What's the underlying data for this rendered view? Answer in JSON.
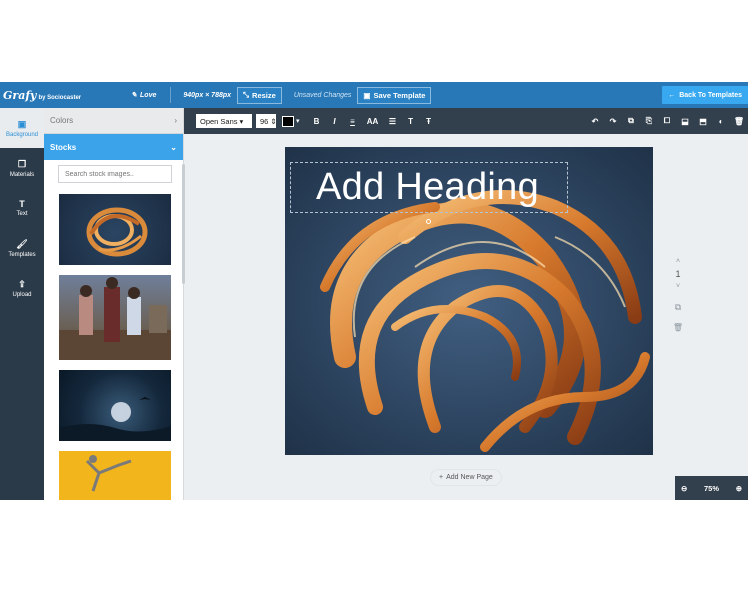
{
  "header": {
    "logo": "Grafy",
    "logo_sub": "by Sociocaster",
    "love_label": "Love",
    "dimensions": "940px × 788px",
    "resize_label": "Resize",
    "unsaved": "Unsaved Changes",
    "save_label": "Save Template",
    "back_label": "Back To Templates"
  },
  "sidebar": {
    "items": [
      {
        "label": "Background",
        "icon": "image-icon"
      },
      {
        "label": "Materials",
        "icon": "copy-icon"
      },
      {
        "label": "Text",
        "icon": "text-icon"
      },
      {
        "label": "Templates",
        "icon": "brush-icon"
      },
      {
        "label": "Upload",
        "icon": "upload-icon"
      }
    ]
  },
  "panel": {
    "colors_label": "Colors",
    "stocks_label": "Stocks",
    "search_placeholder": "Search stock images.."
  },
  "toolbar": {
    "font": "Open Sans",
    "size": "96",
    "text_color": "#000000",
    "bold": "B",
    "italic": "I",
    "caps": "AA",
    "text_t": "T",
    "undo_icon": "undo-icon",
    "redo_icon": "redo-icon"
  },
  "canvas": {
    "heading": "Add Heading"
  },
  "pages": {
    "current": "1"
  },
  "footer": {
    "add_page": "Add New Page",
    "zoom": "75%"
  },
  "colors": {
    "header_bg": "#2878b8",
    "accent": "#3aa3ea",
    "rail_bg": "#2b3a48",
    "toolbar_bg": "#323f4c"
  }
}
